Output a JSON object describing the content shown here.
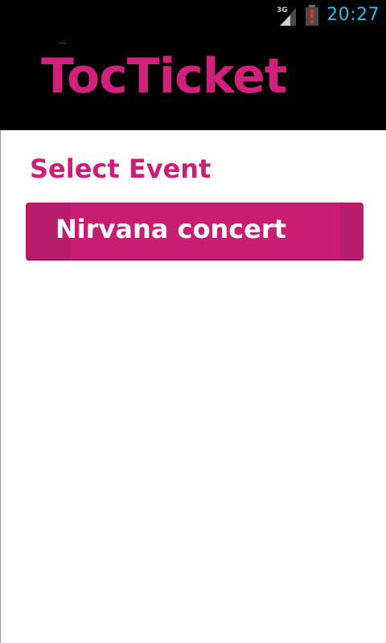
{
  "status_bar": {
    "network_type": "3G",
    "time": "20:27",
    "icons": [
      "signal-icon",
      "alert-icon",
      "battery-icon"
    ],
    "time_color": "#33b5e5"
  },
  "app": {
    "logo": "TocTicket",
    "brand_color": "#d0217d",
    "header_bg": "#000000"
  },
  "main": {
    "title": "Select Event",
    "events": [
      {
        "label": "Nirvana concert"
      }
    ],
    "button_color": "#c91d72"
  }
}
